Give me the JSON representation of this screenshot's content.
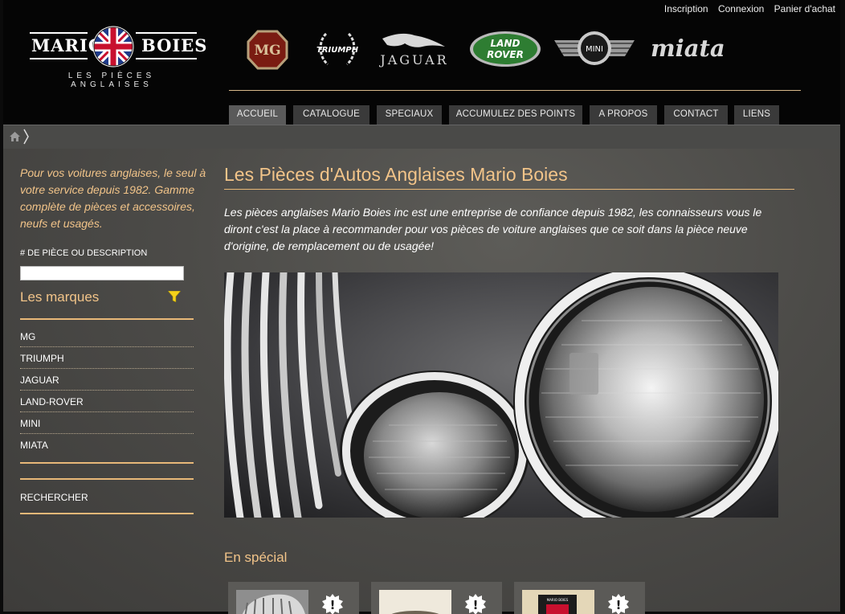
{
  "account_links": [
    "Inscription",
    "Connexion",
    "Panier d'achat"
  ],
  "logo": {
    "name_left": "MARIO",
    "name_right": "BOIES",
    "subtitle": "LES PIÈCES ANGLAISES"
  },
  "brand_logos": {
    "mg": "MG",
    "triumph": "TRIUMPH",
    "jaguar": "JAGUAR",
    "landrover_1": "LAND",
    "landrover_2": "ROVER",
    "mini": "MINI",
    "miata": "miata"
  },
  "nav": [
    "ACCUEIL",
    "CATALOGUE",
    "SPECIAUX",
    "ACCUMULEZ DES POINTS",
    "A PROPOS",
    "CONTACT",
    "LIENS"
  ],
  "nav_active": "ACCUEIL",
  "breadcrumb": {
    "home_icon": "home-icon",
    "separator": "chevron-right-icon"
  },
  "sidebar": {
    "intro": "Pour vos voitures anglaises, le seul à votre service depuis 1982. Gamme complète de pièces et accessoires, neufs et usagés.",
    "search_label": "# DE PIÈCE OU DESCRIPTION",
    "search_value": "",
    "marques_title": "Les marques",
    "marques": [
      "MG",
      "TRIUMPH",
      "JAGUAR",
      "LAND-ROVER",
      "MINI",
      "MIATA"
    ],
    "rechercher": "RECHERCHER"
  },
  "main": {
    "title": "Les Pièces d'Autos Anglaises Mario Boies",
    "description": "Les pièces anglaises Mario Boies inc est une entreprise de confiance depuis 1982, les connaisseurs vous le diront c'est la place à recommander pour vos pièces de voiture anglaises que ce soit dans la pièce neuve d'origine, de remplacement ou de usagée!",
    "special_title": "En spécial",
    "special_badge": "!",
    "special_card3_label": "MARIO BOIES"
  },
  "colors": {
    "accent_gold": "#f2c489",
    "nav_bg": "#3a3a3a",
    "nav_active_bg": "#5a5a5a",
    "landrover_green": "#2e7d32",
    "filter_yellow": "#f5d21a"
  }
}
